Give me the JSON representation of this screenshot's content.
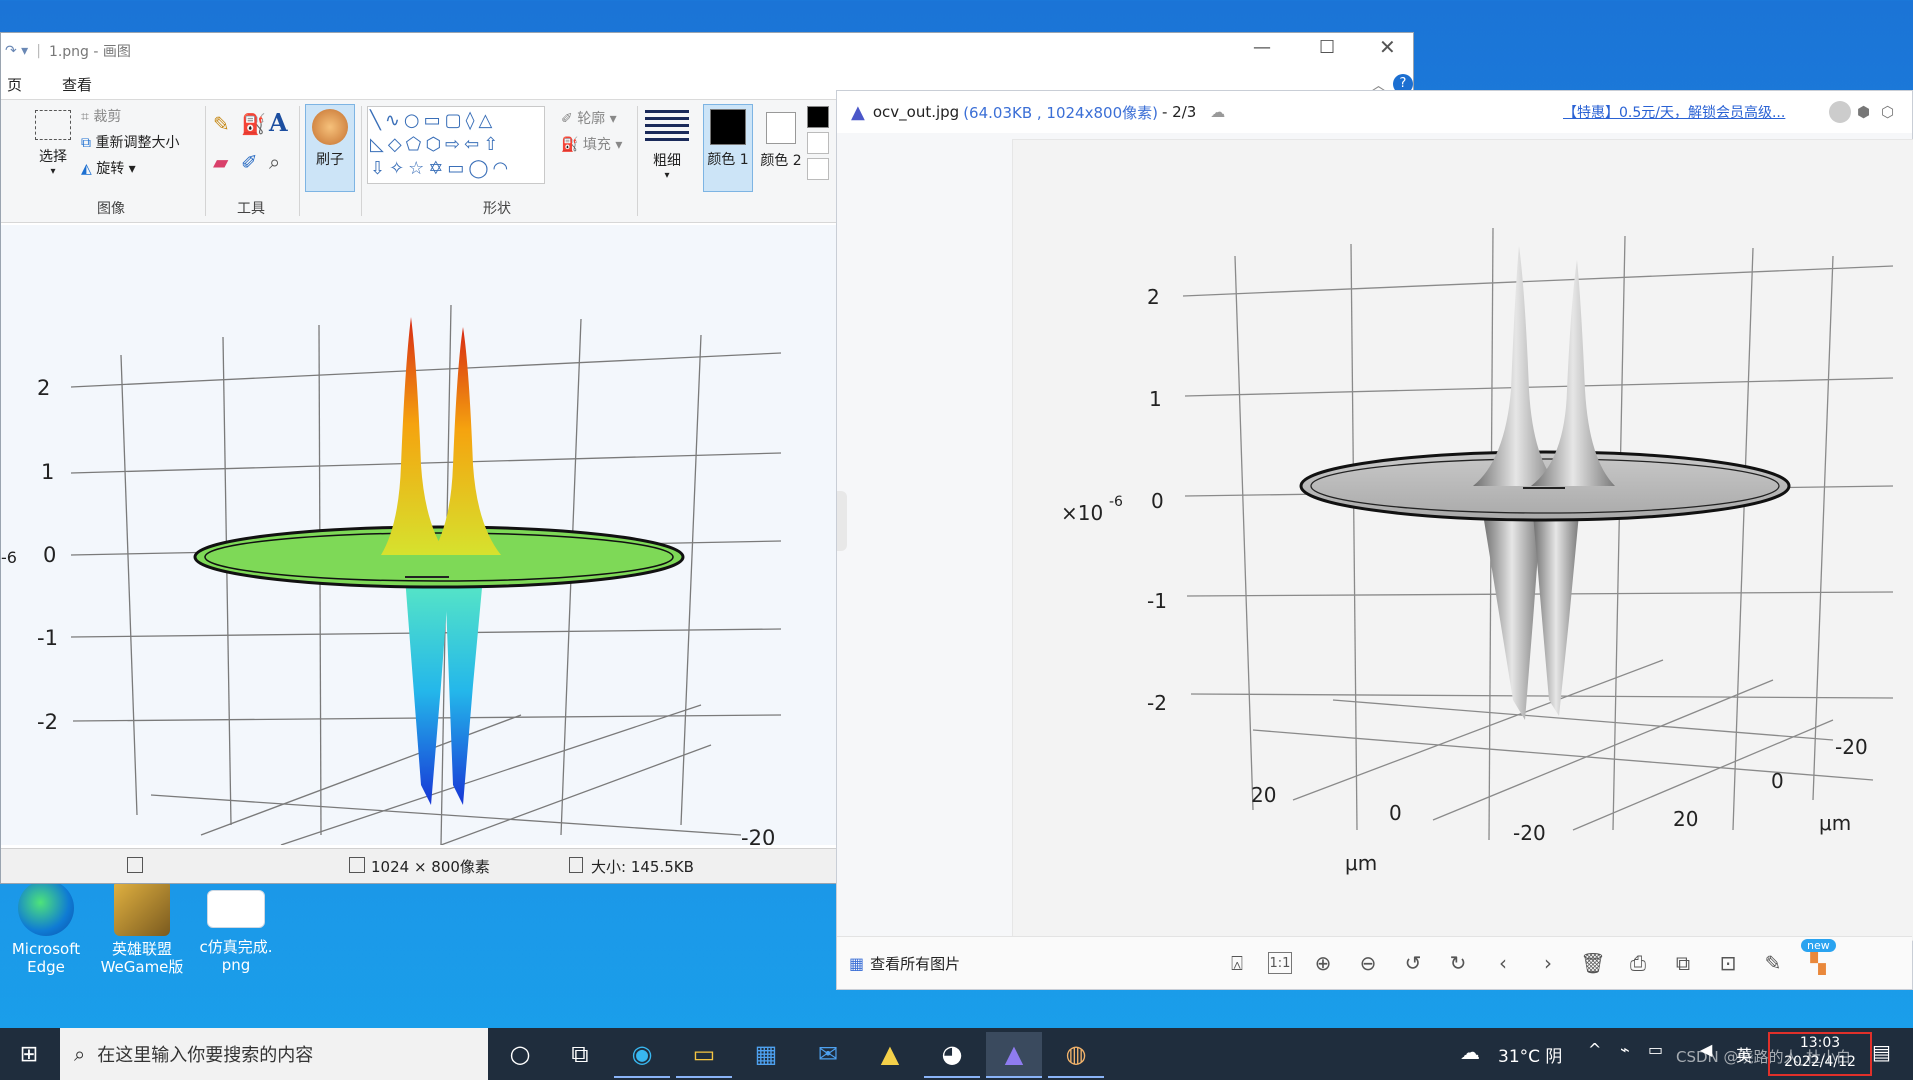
{
  "desktop": {
    "icons": [
      {
        "label": "Microsoft Edge"
      },
      {
        "label": "英雄联盟 WeGame版"
      },
      {
        "label": "c仿真完成. png"
      }
    ]
  },
  "paint": {
    "title": "1.png - 画图",
    "tab_home": "页",
    "tab_view": "查看",
    "select_label": "选择",
    "crop_label": "裁剪",
    "resize_label": "重新调整大小",
    "rotate_label": "旋转",
    "group_image": "图像",
    "group_tools": "工具",
    "brush_label": "刷子",
    "group_shapes": "形状",
    "outline_label": "轮廓",
    "fill_label": "填充",
    "size_label": "粗细",
    "color1_label": "颜色 1",
    "color2_label": "颜色 2",
    "status_dims": "1024 × 800像素",
    "status_size": "大小: 145.5KB",
    "plot": {
      "zticks": [
        "2",
        "1",
        "0",
        "-1",
        "-2"
      ],
      "exp_partial": "-6",
      "xtick_partial": "-20"
    }
  },
  "viewer": {
    "filename": "ocv_out.jpg",
    "fileinfo": "(64.03KB , 1024x800像素)",
    "page": "- 2/3",
    "promo": "【特惠】0.5元/天，解锁会员高级...",
    "view_all": "查看所有图片",
    "new_badge": "new",
    "plot": {
      "zticks": [
        "2",
        "1",
        "0",
        "-1",
        "-2"
      ],
      "scale": "×10",
      "scale_exp": "-6",
      "x_ticks": [
        "20",
        "0",
        "-20"
      ],
      "y_ticks": [
        "-20",
        "0",
        "20"
      ],
      "x_unit": "μm",
      "y_unit": "μm"
    }
  },
  "taskbar": {
    "search_placeholder": "在这里输入你要搜索的内容",
    "weather": "31°C 阴",
    "ime": "英",
    "time": "13:03",
    "date": "2022/4/12",
    "watermark": "CSDN @晓路的人_杜小白"
  }
}
